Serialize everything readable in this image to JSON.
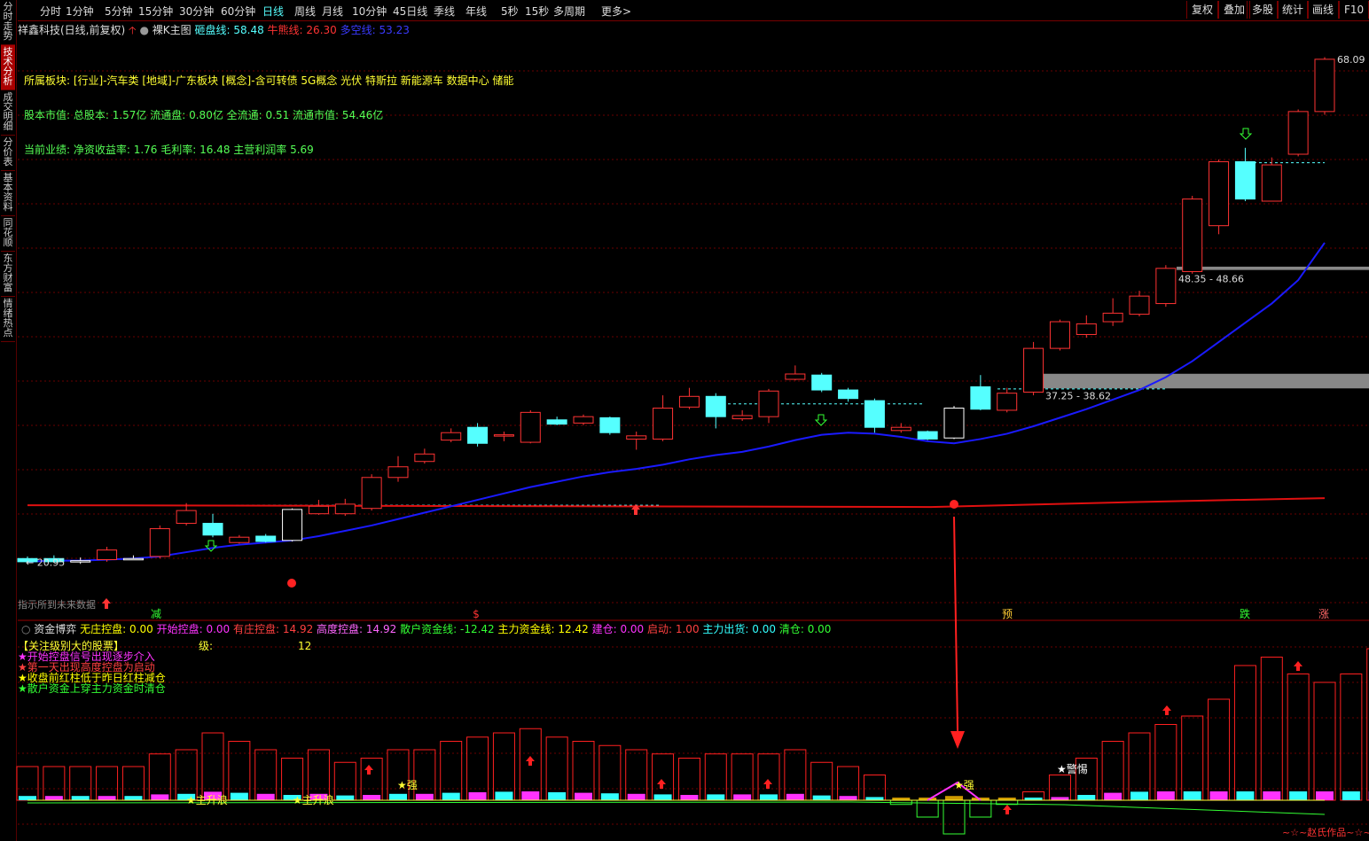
{
  "sidebar": {
    "items": [
      "分时走势",
      "技术分析",
      "成交明细",
      "分价表",
      "基本资料",
      "同花顺",
      "东方财富",
      "情绪热点"
    ],
    "active_index": 1
  },
  "toolbar": {
    "periods": [
      "分时",
      "1分钟",
      "5分钟",
      "15分钟",
      "30分钟",
      "60分钟",
      "日线",
      "周线",
      "月线",
      "10分钟",
      "45日线",
      "季线",
      "年线",
      "5秒",
      "15秒",
      "多周期",
      "更多>"
    ],
    "active_period": "日线",
    "right_buttons": [
      "复权",
      "叠加",
      "多股",
      "统计",
      "画线",
      "F10"
    ]
  },
  "header": {
    "stock_title": "祥鑫科技(日线,前复权)",
    "mode_label": "裸K主图",
    "indicator_a_label": "砸盘线:",
    "indicator_a_value": "58.48",
    "indicator_b_label": "牛熊线:",
    "indicator_b_value": "26.30",
    "indicator_c_label": "多空线:",
    "indicator_c_value": "53.23"
  },
  "fundamentals": {
    "sector_line": "所属板块: [行业]-汽车类 [地域]-广东板块 [概念]-含可转债 5G概念 光伏 特斯拉 新能源车 数据中心 储能",
    "capital_line": "股本市值: 总股本: 1.57亿 流通盘: 0.80亿 全流通: 0.51 流通市值: 54.46亿",
    "perf_line": "当前业绩:  净资收益率: 1.76 毛利率: 16.48 主营利润率 5.69"
  },
  "price_chart": {
    "price_range": [
      18,
      70
    ],
    "high_label": "68.09",
    "low_label": "← 20.95",
    "zone_high": "48.35 - 48.66",
    "zone_mid": "37.25 - 38.62",
    "watermark": "指示所到未来数据",
    "bottom_marks": [
      "减",
      "$",
      "预",
      "跌",
      "涨"
    ],
    "candles": [
      [
        21.0,
        21.3,
        20.9,
        21.5,
        "c"
      ],
      [
        21.0,
        21.3,
        20.9,
        21.6,
        "c"
      ],
      [
        21.0,
        21.1,
        20.8,
        21.4,
        "w"
      ],
      [
        21.2,
        22.1,
        21.0,
        22.4,
        "r"
      ],
      [
        21.3,
        21.3,
        21.2,
        21.6,
        "w"
      ],
      [
        21.5,
        24.1,
        21.3,
        24.4,
        "r"
      ],
      [
        24.6,
        25.8,
        24.4,
        26.5,
        "r"
      ],
      [
        24.6,
        23.5,
        23.3,
        25.5,
        "c"
      ],
      [
        22.8,
        23.3,
        22.7,
        23.5,
        "r"
      ],
      [
        23.4,
        22.9,
        22.8,
        23.6,
        "c"
      ],
      [
        23.0,
        25.9,
        22.9,
        26.0,
        "w"
      ],
      [
        25.5,
        26.2,
        25.4,
        26.8,
        "r"
      ],
      [
        25.5,
        26.4,
        25.3,
        26.9,
        "r"
      ],
      [
        26.0,
        28.9,
        25.8,
        29.2,
        "r"
      ],
      [
        28.9,
        29.9,
        28.5,
        30.9,
        "r"
      ],
      [
        30.4,
        31.1,
        30.2,
        31.6,
        "r"
      ],
      [
        33.1,
        32.4,
        32.2,
        33.5,
        "r"
      ],
      [
        32.1,
        33.6,
        31.8,
        34.0,
        "c"
      ],
      [
        32.8,
        32.9,
        32.3,
        33.2,
        "r"
      ],
      [
        32.2,
        35.0,
        32.1,
        35.2,
        "r"
      ],
      [
        34.3,
        33.9,
        33.8,
        34.6,
        "c"
      ],
      [
        34.0,
        34.6,
        33.8,
        34.8,
        "r"
      ],
      [
        33.1,
        34.5,
        32.9,
        34.6,
        "c"
      ],
      [
        32.5,
        32.8,
        31.5,
        33.2,
        "r"
      ],
      [
        32.5,
        35.4,
        32.3,
        36.6,
        "r"
      ],
      [
        35.5,
        36.5,
        35.3,
        37.3,
        "r"
      ],
      [
        36.5,
        34.6,
        33.5,
        36.8,
        "c"
      ],
      [
        34.4,
        34.7,
        34.2,
        35.2,
        "r"
      ],
      [
        34.6,
        37.0,
        34.0,
        37.2,
        "r"
      ],
      [
        38.1,
        38.6,
        38.0,
        39.4,
        "r"
      ],
      [
        38.5,
        37.1,
        36.9,
        38.7,
        "c"
      ],
      [
        37.1,
        36.3,
        36.0,
        37.3,
        "c"
      ],
      [
        36.1,
        33.6,
        33.1,
        36.3,
        "c"
      ],
      [
        33.3,
        33.6,
        33.1,
        34.0,
        "r"
      ],
      [
        33.2,
        32.5,
        32.4,
        33.3,
        "c"
      ],
      [
        32.6,
        35.4,
        32.5,
        35.6,
        "w"
      ],
      [
        37.4,
        35.3,
        35.2,
        38.5,
        "c"
      ],
      [
        35.2,
        36.8,
        35.0,
        37.3,
        "r"
      ],
      [
        36.9,
        41.0,
        36.6,
        41.6,
        "r"
      ],
      [
        41.0,
        43.5,
        40.8,
        43.7,
        "r"
      ],
      [
        43.3,
        42.3,
        42.0,
        44.1,
        "r"
      ],
      [
        43.5,
        44.3,
        43.1,
        45.7,
        "r"
      ],
      [
        44.2,
        45.9,
        44.0,
        46.4,
        "r"
      ],
      [
        45.2,
        48.5,
        44.9,
        48.8,
        "r"
      ],
      [
        48.2,
        55.0,
        48.0,
        55.3,
        "r"
      ],
      [
        52.5,
        58.5,
        51.7,
        58.7,
        "r"
      ],
      [
        58.5,
        55.0,
        54.8,
        59.8,
        "c"
      ],
      [
        54.8,
        58.2,
        54.8,
        58.9,
        "r"
      ],
      [
        59.2,
        63.2,
        59.0,
        63.4,
        "r"
      ],
      [
        63.2,
        68.1,
        62.9,
        68.3,
        "r"
      ]
    ],
    "ma_blue": [
      21.0,
      21.1,
      21.1,
      21.2,
      21.3,
      21.5,
      21.9,
      22.3,
      22.6,
      22.8,
      23.0,
      23.4,
      23.9,
      24.4,
      25.0,
      25.6,
      26.2,
      26.8,
      27.4,
      28.0,
      28.5,
      29.0,
      29.4,
      29.7,
      30.1,
      30.6,
      31.0,
      31.3,
      31.8,
      32.4,
      32.9,
      33.1,
      33.0,
      32.7,
      32.3,
      32.1,
      32.5,
      33.0,
      33.7,
      34.5,
      35.3,
      36.2,
      37.1,
      38.3,
      39.8,
      41.6,
      43.4,
      45.2,
      47.4,
      50.9
    ],
    "ma_red": 26.3
  },
  "indicator_panel": {
    "title": "资金博弈",
    "values": [
      {
        "label": "无庄控盘:",
        "value": "0.00",
        "color": "#ffff00"
      },
      {
        "label": "开始控盘:",
        "value": "0.00",
        "color": "#ff33ff"
      },
      {
        "label": "有庄控盘:",
        "value": "14.92",
        "color": "#ff4040"
      },
      {
        "label": "高度控盘:",
        "value": "14.92",
        "color": "#ff66ff"
      },
      {
        "label": "散户资金线:",
        "value": "-12.42",
        "color": "#33ff33"
      },
      {
        "label": "主力资金线:",
        "value": "12.42",
        "color": "#ffff00"
      },
      {
        "label": "建仓:",
        "value": "0.00",
        "color": "#ff33ff"
      },
      {
        "label": "启动:",
        "value": "1.00",
        "color": "#ff4040"
      },
      {
        "label": "主力出货:",
        "value": "0.00",
        "color": "#33ffff"
      },
      {
        "label": "清仓:",
        "value": "0.00",
        "color": "#33ff33"
      }
    ],
    "focus_title": "【关注级别大的股票】",
    "level_label": "级:",
    "level_value": "12",
    "legend": [
      {
        "text": "★开始控盘信号出现逐步介入",
        "color": "#ff33ff"
      },
      {
        "text": "★第一天出现高度控盘为启动",
        "color": "#ff4040"
      },
      {
        "text": "★收盘前红柱低于昨日红柱减仓",
        "color": "#ffff00"
      },
      {
        "text": "★散户资金上穿主力资金时清仓",
        "color": "#33ff33"
      }
    ],
    "markers": [
      "★主升浪",
      "★主升浪",
      "★强",
      "★强",
      "★警惕"
    ],
    "footer": "~☆~赵氏作品~☆~",
    "bars": [
      4,
      4,
      4,
      4,
      4,
      5.5,
      6,
      8,
      7,
      6,
      5,
      6,
      4.5,
      5,
      6,
      6,
      7,
      7.5,
      8,
      8.5,
      7.5,
      7,
      6.5,
      6,
      5.5,
      5,
      5.5,
      5.5,
      5.5,
      6,
      4.5,
      4,
      3,
      -0.5,
      -2,
      -4,
      -2,
      -0.5,
      1,
      3,
      5,
      7,
      8,
      9,
      10,
      12,
      16,
      17,
      15,
      14,
      15,
      18
    ]
  },
  "colors": {
    "up": "#ff3333",
    "down": "#55ffff",
    "ma_blue": "#1a1aff",
    "ma_red": "#e01010",
    "grid": "#6a0000",
    "text_green": "#55ff55",
    "text_yellow": "#ffff33"
  }
}
